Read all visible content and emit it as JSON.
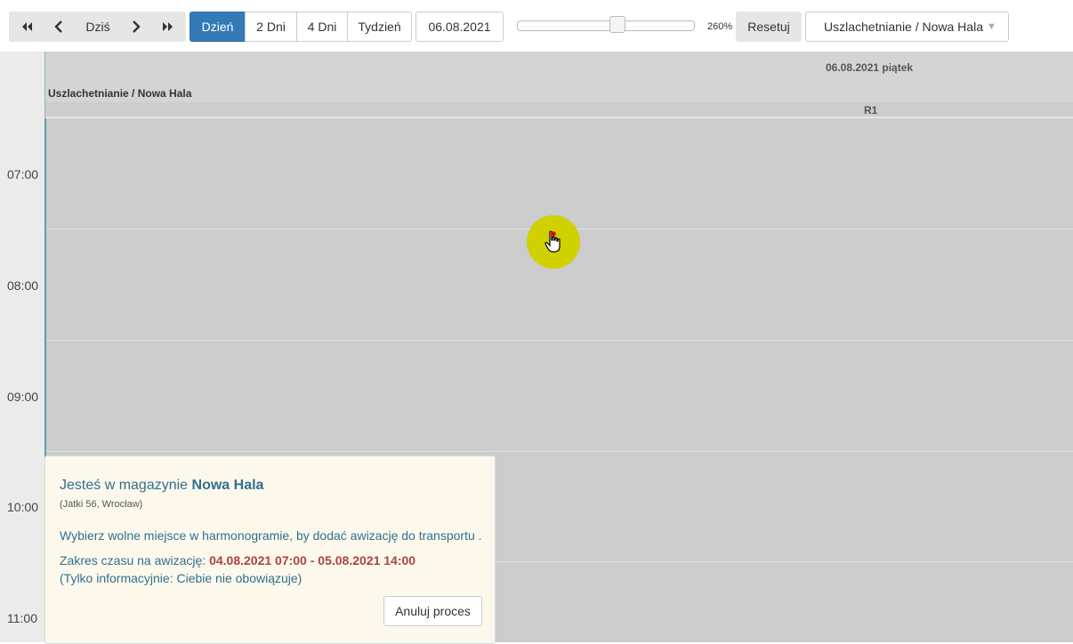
{
  "toolbar": {
    "today_label": "Dziś",
    "views": [
      {
        "label": "Dzień",
        "active": true
      },
      {
        "label": "2 Dni",
        "active": false
      },
      {
        "label": "4 Dni",
        "active": false
      },
      {
        "label": "Tydzień",
        "active": false
      }
    ],
    "date_value": "06.08.2021",
    "zoom": {
      "label": "260%",
      "value_fraction": 0.58
    },
    "reset_label": "Resetuj",
    "warehouse_select": "Uszlachetnianie / Nowa Hala",
    "accent_color": "#337ab7"
  },
  "calendar": {
    "day_header": "06.08.2021 piątek",
    "resource_header": "Uszlachetnianie / Nowa Hala",
    "column_header": "R1",
    "times": [
      "07:00",
      "08:00",
      "09:00",
      "10:00",
      "11:00"
    ]
  },
  "info_panel": {
    "title_prefix": "Jesteś w magazynie",
    "warehouse": "Nowa Hala",
    "address": "(Jatki 56, Wrocław)",
    "instruction": "Wybierz wolne miejsce w harmonogramie, by dodać awizację do transportu .",
    "range_label": "Zakres czasu na awizację:",
    "range_value": "04.08.2021 07:00 - 05.08.2021 14:00",
    "note": "(Tylko informacyjnie: Ciebie nie obowiązuje)",
    "cancel_label": "Anuluj proces"
  },
  "icons": [
    "double-chevron-left-icon",
    "chevron-left-icon",
    "chevron-right-icon",
    "double-chevron-right-icon",
    "caret-down-icon",
    "hand-pointer-icon"
  ]
}
